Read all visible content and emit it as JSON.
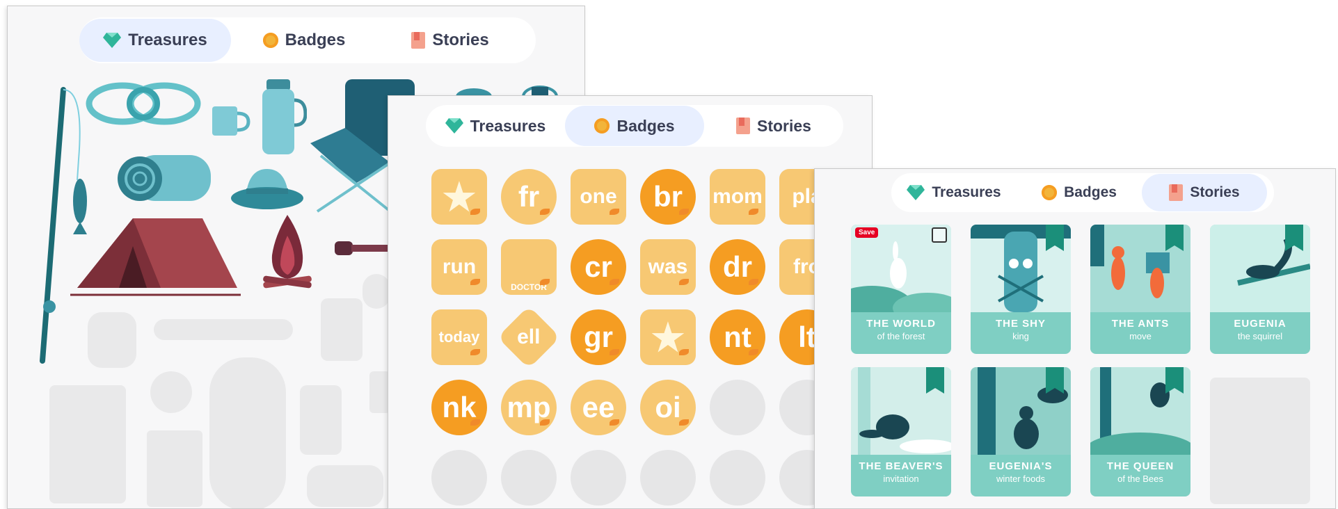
{
  "panels": {
    "treasures": {
      "tabs": [
        {
          "label": "Treasures",
          "icon": "diamond-icon",
          "active": true
        },
        {
          "label": "Badges",
          "icon": "coin-icon",
          "active": false
        },
        {
          "label": "Stories",
          "icon": "book-icon",
          "active": false
        }
      ]
    },
    "badges": {
      "tabs": [
        {
          "label": "Treasures",
          "icon": "diamond-icon",
          "active": false
        },
        {
          "label": "Badges",
          "icon": "coin-icon",
          "active": true
        },
        {
          "label": "Stories",
          "icon": "book-icon",
          "active": false
        }
      ],
      "grid": [
        [
          "★",
          "fr",
          "one",
          "br",
          "mom",
          "pla"
        ],
        [
          "run",
          "DOCTOR",
          "cr",
          "was",
          "dr",
          "fro"
        ],
        [
          "today",
          "ell",
          "gr",
          "★",
          "nt",
          "lt"
        ],
        [
          "nk",
          "mp",
          "ee",
          "oi",
          "",
          ""
        ],
        [
          "",
          "",
          "",
          "",
          "",
          ""
        ]
      ]
    },
    "stories": {
      "tabs": [
        {
          "label": "Treasures",
          "icon": "diamond-icon",
          "active": false
        },
        {
          "label": "Badges",
          "icon": "coin-icon",
          "active": false
        },
        {
          "label": "Stories",
          "icon": "book-icon",
          "active": true
        }
      ],
      "save_label": "Save",
      "cards": [
        {
          "title": "THE WORLD",
          "subtitle": "of the forest"
        },
        {
          "title": "THE SHY",
          "subtitle": "king"
        },
        {
          "title": "THE ANTS",
          "subtitle": "move"
        },
        {
          "title": "EUGENIA",
          "subtitle": "the squirrel"
        },
        {
          "title": "THE BEAVER'S",
          "subtitle": "invitation"
        },
        {
          "title": "EUGENIA'S",
          "subtitle": "winter foods"
        },
        {
          "title": "THE QUEEN",
          "subtitle": "of the Bees"
        }
      ]
    }
  },
  "colors": {
    "active_tab_bg": "#e8efff",
    "tab_text": "#3a3f55",
    "teal": "#1b8f7a",
    "story_card": "#7fcfc3",
    "badge_light": "#f7c873",
    "badge_dark": "#f59d22",
    "tent": "#a4454d"
  }
}
